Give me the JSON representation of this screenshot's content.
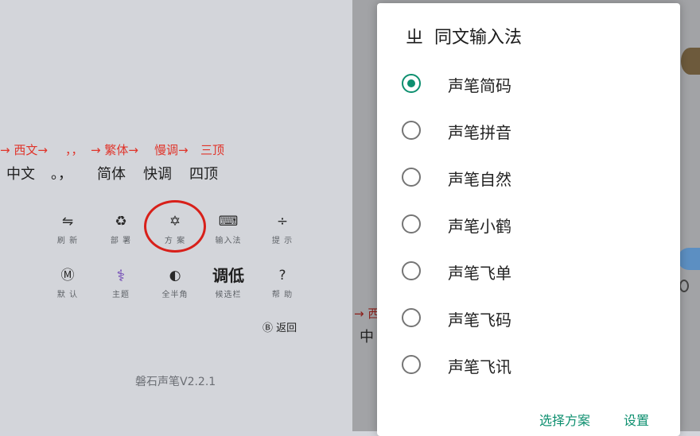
{
  "keyboard": {
    "arrow_row": [
      "→ 西文→",
      "，，",
      "→ 繁体→",
      "慢调→",
      "三顶"
    ],
    "mode_row": [
      "中文",
      "。，",
      "简体",
      "快调",
      "四顶"
    ],
    "keys_row1": [
      {
        "glyph": "⇋",
        "label": "刷 新",
        "icon": "refresh-icon"
      },
      {
        "glyph": "♻",
        "label": "部 署",
        "icon": "recycle-icon"
      },
      {
        "glyph": "✡",
        "label": "方 案",
        "icon": "star-of-david-icon"
      },
      {
        "glyph": "⌨",
        "label": "输入法",
        "icon": "keyboard-icon"
      },
      {
        "glyph": "÷",
        "label": "提 示",
        "icon": "divide-icon"
      }
    ],
    "keys_row2": [
      {
        "glyph": "Ⓜ",
        "label": "默 认",
        "icon": "circled-m-icon"
      },
      {
        "glyph": "⚕",
        "label": "主题",
        "icon": "caduceus-icon"
      },
      {
        "glyph": "◐",
        "label": "全半角",
        "icon": "half-circle-icon"
      },
      {
        "glyph": "调低",
        "label": "候选栏",
        "icon": ""
      },
      {
        "glyph": "?",
        "label": "帮 助",
        "icon": "question-icon"
      }
    ],
    "return_label": "Ⓑ 返回",
    "version": "磐石声笔V2.2.1"
  },
  "background_fragments": {
    "frag1": "→ 西",
    "frag2": "中"
  },
  "dialog": {
    "title": "同文输入法",
    "title_icon": "ㄓ",
    "options": [
      {
        "label": "声笔简码",
        "selected": true
      },
      {
        "label": "声笔拼音",
        "selected": false
      },
      {
        "label": "声笔自然",
        "selected": false
      },
      {
        "label": "声笔小鹤",
        "selected": false
      },
      {
        "label": "声笔飞单",
        "selected": false
      },
      {
        "label": "声笔飞码",
        "selected": false
      },
      {
        "label": "声笔飞讯",
        "selected": false
      }
    ],
    "buttons": {
      "select": "选择方案",
      "settings": "设置"
    }
  },
  "colors": {
    "accent": "#0d8f6f",
    "arrow_red": "#e0342a",
    "circle_red": "#d8201a"
  }
}
